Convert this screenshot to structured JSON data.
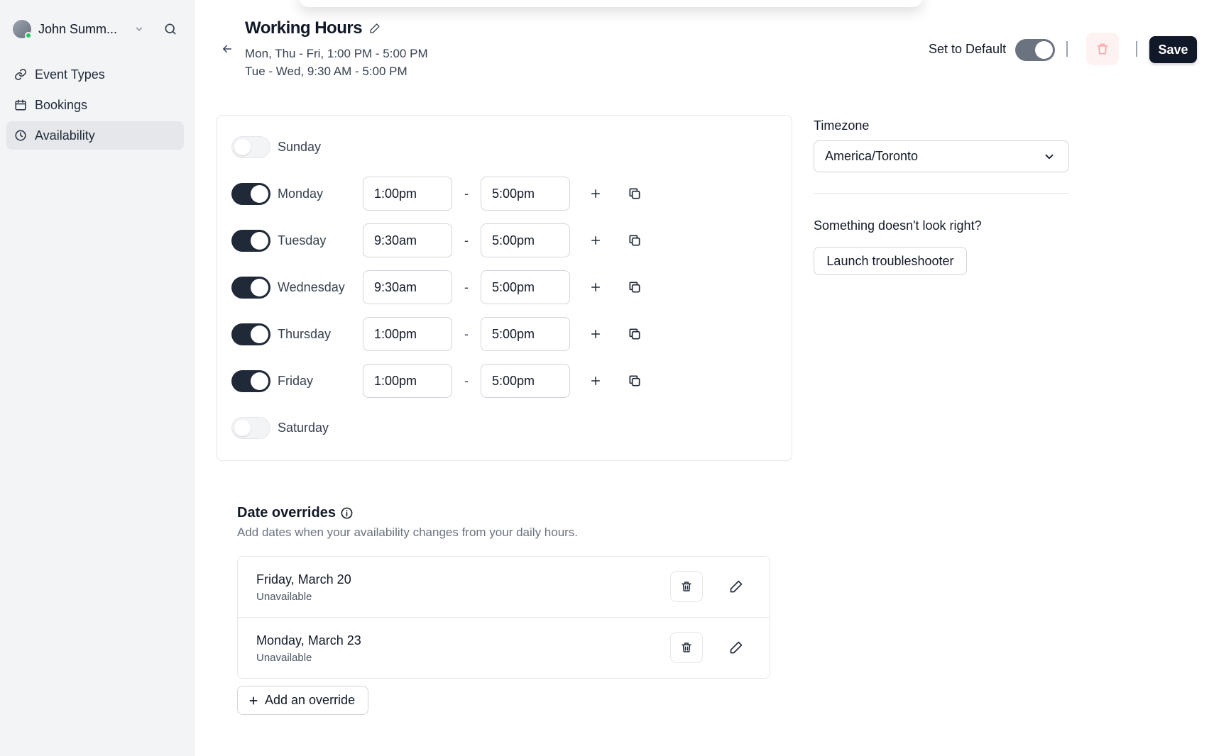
{
  "user": {
    "name": "John Summ..."
  },
  "sidebar": {
    "items": [
      {
        "label": "Event Types",
        "icon": "link-icon"
      },
      {
        "label": "Bookings",
        "icon": "calendar-icon"
      },
      {
        "label": "Availability",
        "icon": "clock-icon",
        "active": true
      }
    ]
  },
  "header": {
    "title": "Working Hours",
    "subtitle_line1": "Mon, Thu - Fri, 1:00 PM - 5:00 PM",
    "subtitle_line2": "Tue - Wed, 9:30 AM - 5:00 PM",
    "set_default_label": "Set to Default",
    "save_label": "Save"
  },
  "schedule": {
    "days": [
      {
        "label": "Sunday",
        "enabled": false
      },
      {
        "label": "Monday",
        "enabled": true,
        "start": "1:00pm",
        "end": "5:00pm"
      },
      {
        "label": "Tuesday",
        "enabled": true,
        "start": "9:30am",
        "end": "5:00pm"
      },
      {
        "label": "Wednesday",
        "enabled": true,
        "start": "9:30am",
        "end": "5:00pm"
      },
      {
        "label": "Thursday",
        "enabled": true,
        "start": "1:00pm",
        "end": "5:00pm"
      },
      {
        "label": "Friday",
        "enabled": true,
        "start": "1:00pm",
        "end": "5:00pm"
      },
      {
        "label": "Saturday",
        "enabled": false
      }
    ],
    "separator": "-"
  },
  "timezone": {
    "label": "Timezone",
    "value": "America/Toronto"
  },
  "troubleshooter": {
    "question": "Something doesn't look right?",
    "button_label": "Launch troubleshooter"
  },
  "overrides": {
    "title": "Date overrides",
    "description": "Add dates when your availability changes from your daily hours.",
    "items": [
      {
        "date": "Friday, March 20",
        "status": "Unavailable"
      },
      {
        "date": "Monday, March 23",
        "status": "Unavailable"
      }
    ],
    "add_label": "Add an override"
  },
  "colors": {
    "accent": "#111827",
    "sidebar_bg": "#f3f4f6",
    "online": "#22c55e",
    "danger_soft": "#fef2f2"
  }
}
